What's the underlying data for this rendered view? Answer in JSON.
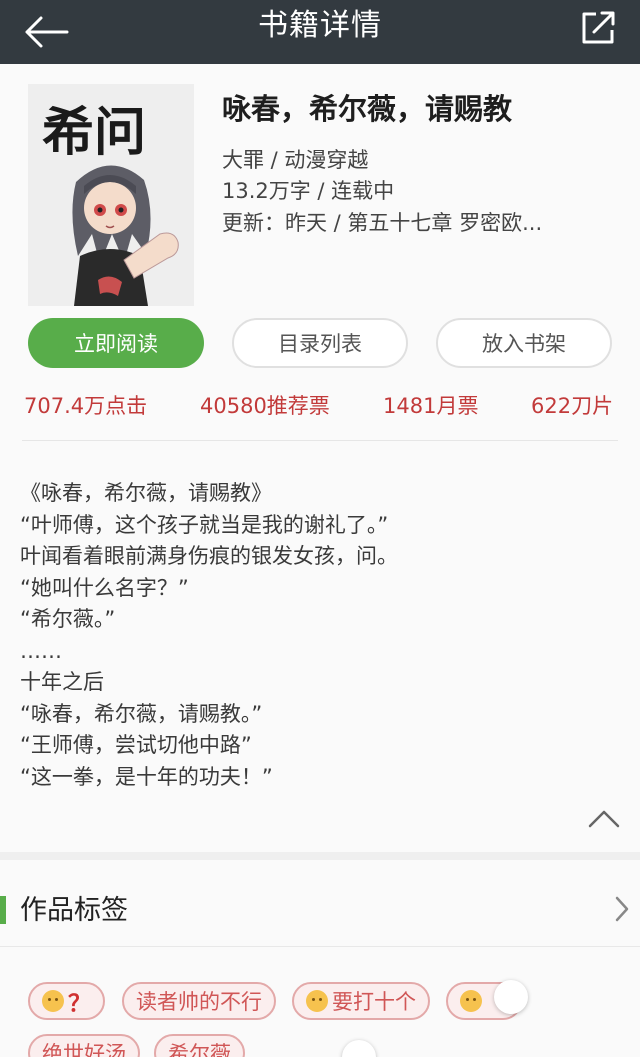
{
  "header": {
    "title": "书籍详情",
    "back_icon": "arrow-left-icon",
    "share_icon": "share-icon"
  },
  "book": {
    "title": "咏春，希尔薇，请赐教",
    "category": "大罪 / 动漫穿越",
    "words_status": "13.2万字 / 连载中",
    "update": "更新：昨天 / 第五十七章  罗密欧...",
    "cover_text": "希问"
  },
  "actions": {
    "read": "立即阅读",
    "toc": "目录列表",
    "shelf": "放入书架"
  },
  "stats": {
    "clicks": "707.4万点击",
    "recommend": "40580推荐票",
    "monthly": "1481月票",
    "blades": "622刀片"
  },
  "intro": {
    "lines": [
      "《咏春，希尔薇，请赐教》",
      "“叶师傅，这个孩子就当是我的谢礼了。”",
      "叶闻看着眼前满身伤痕的银发女孩，问。",
      "“她叫什么名字？”",
      "“希尔薇。”",
      "……",
      "十年之后",
      "“咏春，希尔薇，请赐教。”",
      "“王师傅，尝试切他中路”",
      "“这一拳，是十年的功夫！”"
    ]
  },
  "tags_section": {
    "title": "作品标签",
    "tags": [
      {
        "text": "？",
        "emoji": true
      },
      {
        "text": "读者帅的不行",
        "emoji": false
      },
      {
        "text": "要打十个",
        "emoji": true
      },
      {
        "text": "",
        "emoji": true
      },
      {
        "text": "绝世好汤",
        "emoji": false
      },
      {
        "text": "希尔薇",
        "emoji": false
      }
    ]
  },
  "colors": {
    "header_bg": "#333a40",
    "accent_green": "#58ad4a",
    "stat_red": "#c23a3a",
    "tag_red": "#d05656"
  }
}
